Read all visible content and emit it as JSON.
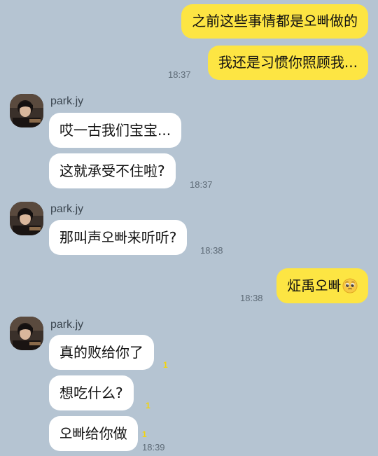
{
  "messages_out_top": [
    {
      "text": "之前这些事情都是오빠做的"
    },
    {
      "text": "我还是习惯你照顾我..."
    }
  ],
  "ts_out_1": "18:37",
  "groups": [
    {
      "sender": "park.jy",
      "messages": [
        {
          "text": "哎一古我们宝宝..."
        },
        {
          "text": "这就承受不住啦?"
        }
      ],
      "time": "18:37"
    },
    {
      "sender": "park.jy",
      "messages": [
        {
          "text": "那叫声오빠来听听?"
        }
      ],
      "time": "18:38"
    },
    {
      "sender": "park.jy",
      "messages": [
        {
          "text": "真的败给你了",
          "unread": "1"
        },
        {
          "text": "想吃什么?",
          "unread": "1"
        },
        {
          "text": "오빠给你做",
          "unread": "1"
        }
      ],
      "time": "18:39"
    }
  ],
  "out_reply": {
    "text": "炡禹오빠",
    "emoji": "pleading-face-icon"
  },
  "ts_out_2": "18:38"
}
